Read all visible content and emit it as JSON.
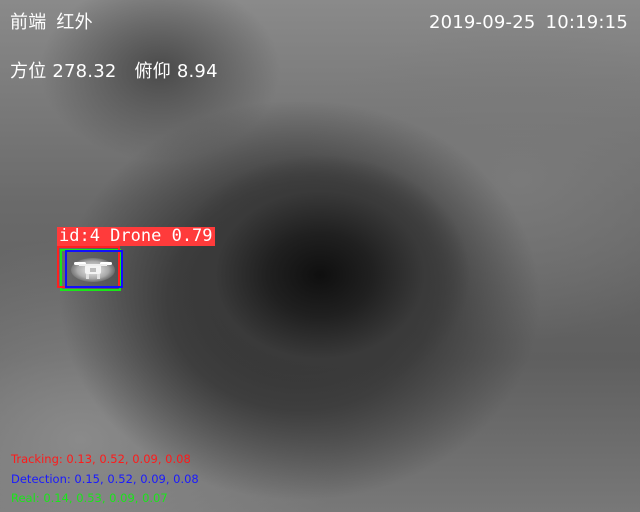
{
  "osd": {
    "source": "前端",
    "mode": "红外",
    "date": "2019-09-25",
    "time": "10:19:15",
    "azimuth_label": "方位",
    "azimuth_value": "278.32",
    "pitch_label": "俯仰",
    "pitch_value": "8.94"
  },
  "detection": {
    "label": "id:4 Drone 0.79"
  },
  "legend": {
    "tracking": "Tracking: 0.13, 0.52, 0.09, 0.08",
    "detection": "Detection: 0.15, 0.52, 0.09, 0.08",
    "real": "Real: 0.14, 0.53, 0.09, 0.07"
  },
  "colors": {
    "tracking": "#ff2020",
    "detection": "#1010ff",
    "real": "#19e619",
    "label_background": "#ff3b3b",
    "osd_text": "#ffffff"
  }
}
